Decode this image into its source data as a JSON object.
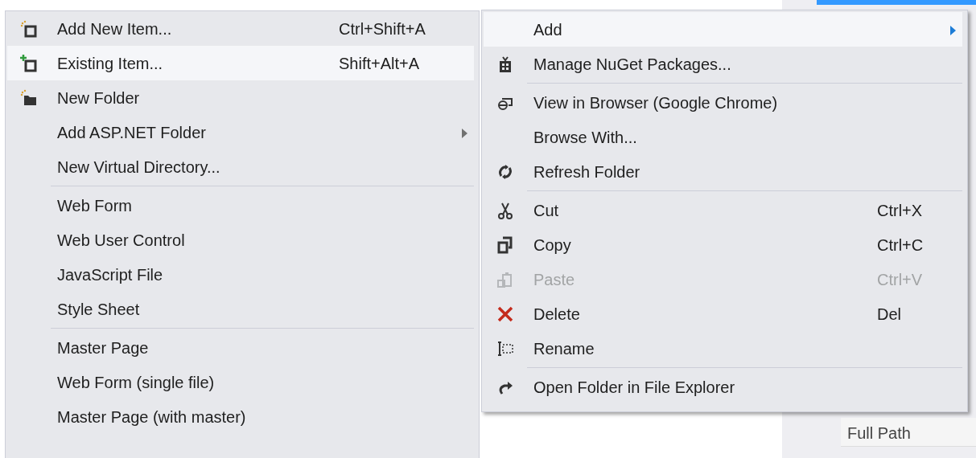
{
  "background_panel": {
    "property_label": "Full Path"
  },
  "submenu": {
    "items": [
      {
        "kind": "item",
        "label": "Add New Item...",
        "shortcut": "Ctrl+Shift+A",
        "has_submenu": false,
        "selected": false
      },
      {
        "kind": "item",
        "label": "Existing Item...",
        "shortcut": "Shift+Alt+A",
        "has_submenu": false,
        "selected": true
      },
      {
        "kind": "item",
        "label": "New Folder",
        "has_submenu": false,
        "selected": false
      },
      {
        "kind": "item",
        "label": "Add ASP.NET Folder",
        "has_submenu": true,
        "selected": false
      },
      {
        "kind": "item",
        "label": "New Virtual Directory...",
        "has_submenu": false,
        "selected": false
      },
      {
        "kind": "separator"
      },
      {
        "kind": "item",
        "label": "Web Form",
        "has_submenu": false,
        "selected": false
      },
      {
        "kind": "item",
        "label": "Web User Control",
        "has_submenu": false,
        "selected": false
      },
      {
        "kind": "item",
        "label": "JavaScript File",
        "has_submenu": false,
        "selected": false
      },
      {
        "kind": "item",
        "label": "Style Sheet",
        "has_submenu": false,
        "selected": false
      },
      {
        "kind": "separator"
      },
      {
        "kind": "item",
        "label": "Master Page",
        "has_submenu": false,
        "selected": false
      },
      {
        "kind": "item",
        "label": "Web Form (single file)",
        "has_submenu": false,
        "selected": false
      },
      {
        "kind": "item",
        "label": "Master Page (with master)",
        "has_submenu": false,
        "selected": false
      }
    ]
  },
  "context_menu": {
    "items": [
      {
        "kind": "item",
        "label": "Add",
        "has_submenu": true,
        "selected": true,
        "disabled": false
      },
      {
        "kind": "item",
        "label": "Manage NuGet Packages...",
        "has_submenu": false,
        "selected": false,
        "disabled": false
      },
      {
        "kind": "separator"
      },
      {
        "kind": "item",
        "label": "View in Browser (Google Chrome)",
        "has_submenu": false,
        "selected": false,
        "disabled": false
      },
      {
        "kind": "item",
        "label": "Browse With...",
        "has_submenu": false,
        "selected": false,
        "disabled": false
      },
      {
        "kind": "item",
        "label": "Refresh Folder",
        "has_submenu": false,
        "selected": false,
        "disabled": false
      },
      {
        "kind": "separator"
      },
      {
        "kind": "item",
        "label": "Cut",
        "shortcut": "Ctrl+X",
        "has_submenu": false,
        "selected": false,
        "disabled": false
      },
      {
        "kind": "item",
        "label": "Copy",
        "shortcut": "Ctrl+C",
        "has_submenu": false,
        "selected": false,
        "disabled": false
      },
      {
        "kind": "item",
        "label": "Paste",
        "shortcut": "Ctrl+V",
        "has_submenu": false,
        "selected": false,
        "disabled": true
      },
      {
        "kind": "item",
        "label": "Delete",
        "shortcut": "Del",
        "has_submenu": false,
        "selected": false,
        "disabled": false
      },
      {
        "kind": "item",
        "label": "Rename",
        "has_submenu": false,
        "selected": false,
        "disabled": false
      },
      {
        "kind": "separator"
      },
      {
        "kind": "item",
        "label": "Open Folder in File Explorer",
        "has_submenu": false,
        "selected": false,
        "disabled": false
      }
    ]
  }
}
